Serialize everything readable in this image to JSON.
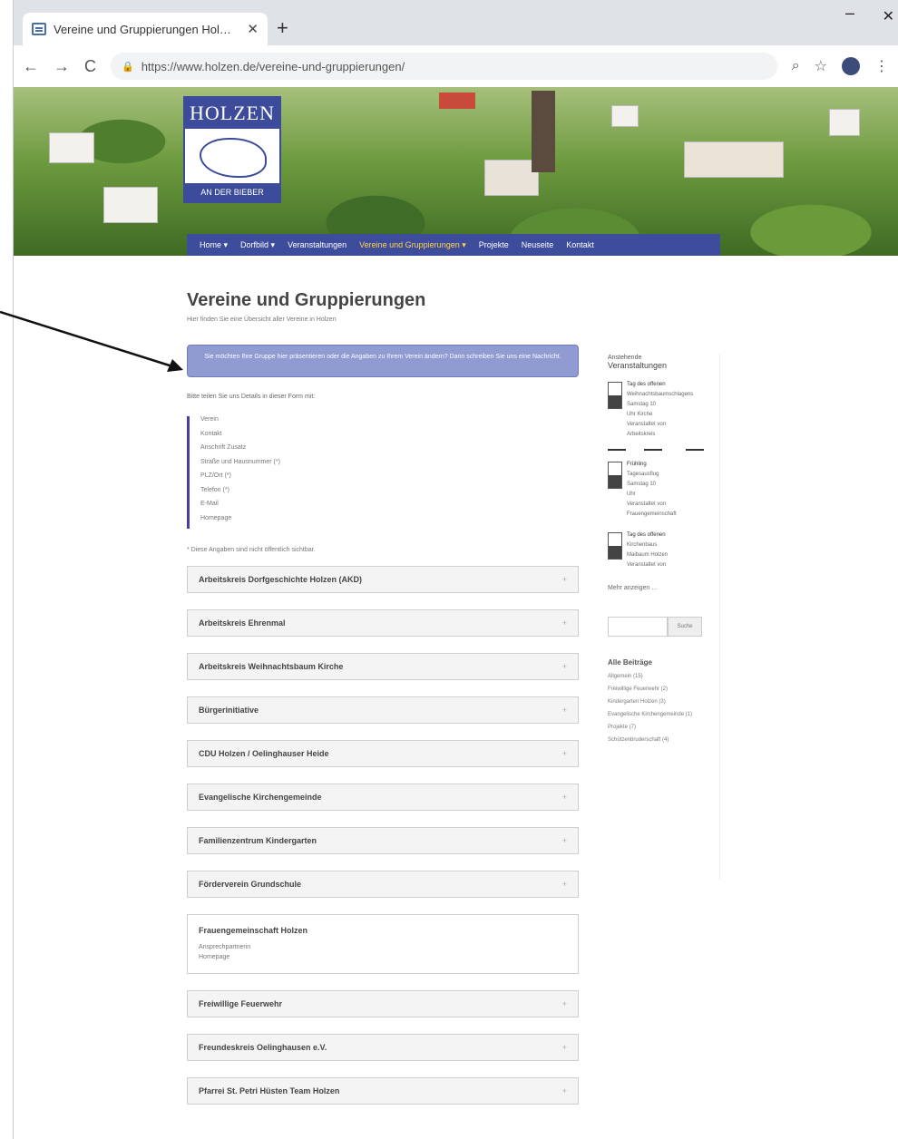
{
  "browser": {
    "tab_title": "Vereine und Gruppierungen Hol…",
    "tab_close": "✕",
    "new_tab": "+",
    "minimize": "–",
    "close": "✕",
    "back": "←",
    "forward": "→",
    "reload": "C",
    "lock": "🔒",
    "url": "https://www.holzen.de/vereine-und-gruppierungen/",
    "zoom_icon": "⌕",
    "star_icon": "☆",
    "menu_icon": "⋮"
  },
  "site": {
    "logo_top": "HOLZEN",
    "logo_bottom": "AN DER BIEBER",
    "nav": [
      {
        "label": "Home ▾"
      },
      {
        "label": "Dorfbild ▾"
      },
      {
        "label": "Veranstaltungen"
      },
      {
        "label": "Vereine und Gruppierungen ▾"
      },
      {
        "label": "Projekte"
      },
      {
        "label": "Neuseite"
      },
      {
        "label": "Kontakt"
      }
    ]
  },
  "main": {
    "title": "Vereine und Gruppierungen",
    "subtitle": "Hier finden Sie eine Übersicht aller Vereine in Holzen",
    "notice": "Sie möchten Ihre Gruppe hier präsentieren oder die Angaben zu Ihrem Verein ändern? Dann schreiben Sie uns eine Nachricht.",
    "intro": "Bitte teilen Sie uns Details in dieser Form mit:",
    "form_fields": [
      "Verein",
      "Kontakt",
      "Anschrift Zusatz",
      "Straße und Hausnummer (*)",
      "PLZ/Ort (*)",
      "Telefon (*)",
      "E-Mail",
      "Homepage"
    ],
    "footnote": "* Diese Angaben sind nicht öffentlich sichtbar.",
    "groups": [
      {
        "title": "Arbeitskreis Dorfgeschichte Holzen (AKD)",
        "icon": "+"
      },
      {
        "title": "Arbeitskreis Ehrenmal",
        "icon": "+"
      },
      {
        "title": "Arbeitskreis Weihnachtsbaum Kirche",
        "icon": "+"
      },
      {
        "title": "Bürgerinitiative",
        "icon": "+"
      },
      {
        "title": "CDU Holzen / Oelinghauser Heide",
        "icon": "+"
      },
      {
        "title": "Evangelische Kirchengemeinde",
        "icon": "+"
      },
      {
        "title": "Familienzentrum Kindergarten",
        "icon": "+"
      },
      {
        "title": "Förderverein Grundschule",
        "icon": "+"
      }
    ],
    "open_group": {
      "title": "Frauengemeinschaft Holzen",
      "line1": "Ansprechpartnerin",
      "line2": "Homepage"
    },
    "groups_after": [
      {
        "title": "Freiwillige Feuerwehr",
        "icon": "+"
      },
      {
        "title": "Freundeskreis Oelinghausen e.V.",
        "icon": "+"
      },
      {
        "title": "Pfarrei St. Petri Hüsten Team Holzen",
        "icon": "+"
      }
    ]
  },
  "sidebar": {
    "heading_small": "Anstehende",
    "heading": "Veranstaltungen",
    "events": [
      {
        "title": "Tag des offenen",
        "l2": "Weihnachtsbaumschlagens",
        "l3": "Samstag 10",
        "l4": "Uhr Kirche",
        "l5": "Veranstaltet von",
        "l6": "Arbeitskreis"
      },
      {
        "title": "Frühling",
        "l2": "Tagesausflug",
        "l3": "Samstag 10",
        "l4": "Uhr",
        "l5": "Veranstaltet von",
        "l6": "Frauengemeinschaft"
      },
      {
        "title": "Tag des offenen",
        "l2": "Kirchenbaus",
        "l3": "Maibaum Holzen",
        "l4": "Veranstaltet von",
        "l5": "",
        "l6": ""
      }
    ],
    "more": "Mehr anzeigen …",
    "search_button": "Suche",
    "categories_heading": "Alle Beiträge",
    "categories": [
      "Allgemein (15)",
      "Freiwillige Feuerwehr (2)",
      "Kindergarten Holzen (3)",
      "Evangelische Kirchengemeinde (1)",
      "Projekte (7)",
      "Schützenbruderschaft (4)"
    ]
  }
}
